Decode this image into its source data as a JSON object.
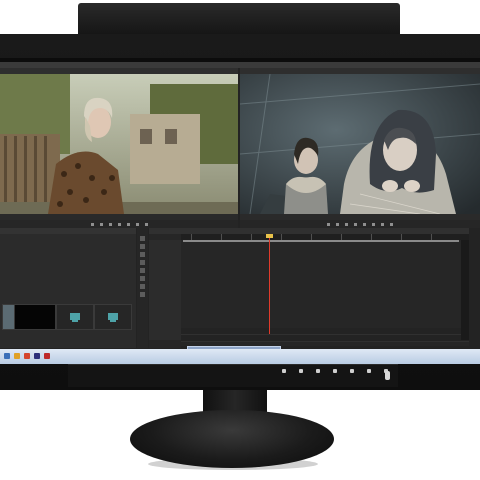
{
  "product": {
    "brand_text": "",
    "panel_buttons": [
      "",
      "",
      "",
      "",
      "",
      "",
      ""
    ]
  },
  "app": {
    "menu": [
      "",
      "",
      "",
      "",
      "",
      "",
      ""
    ],
    "source_monitor": {
      "timecode_in": "",
      "timecode_out": ""
    },
    "program_monitor": {
      "timecode_in": "",
      "timecode_out": ""
    },
    "project_clips": [
      {
        "name": ""
      },
      {
        "name": ""
      },
      {
        "name": ""
      },
      {
        "name": ""
      }
    ],
    "timeline": {
      "clip_label": ""
    }
  },
  "colors": {
    "timecode": "#d9a83a",
    "playhead": "#e03b2b",
    "clip": "#8fa6c9",
    "taskbar": "#c8d8ec"
  }
}
